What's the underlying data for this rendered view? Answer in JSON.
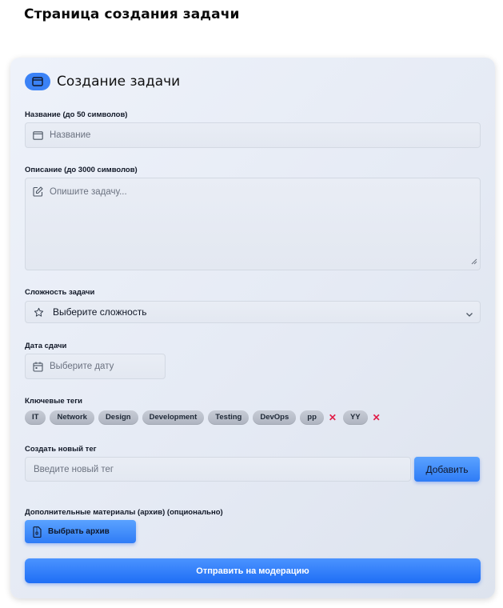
{
  "page": {
    "title": "Страница создания задачи"
  },
  "card": {
    "title": "Создание задачи"
  },
  "form": {
    "name_label": "Название (до 50 символов)",
    "name_placeholder": "Название",
    "desc_label": "Описание (до 3000 символов)",
    "desc_placeholder": "Опишите задачу...",
    "difficulty_label": "Сложность задачи",
    "difficulty_value": "Выберите сложность",
    "date_label": "Дата сдачи",
    "date_placeholder": "Выберите дату",
    "tags_label": "Ключевые теги",
    "tags": [
      {
        "label": "IT",
        "removable": false
      },
      {
        "label": "Network",
        "removable": false
      },
      {
        "label": "Design",
        "removable": false
      },
      {
        "label": "Development",
        "removable": false
      },
      {
        "label": "Testing",
        "removable": false
      },
      {
        "label": "DevOps",
        "removable": false
      },
      {
        "label": "pp",
        "removable": true
      },
      {
        "label": "YY",
        "removable": true
      }
    ],
    "tag_remove_glyph": "✕",
    "new_tag_label": "Создать новый тег",
    "new_tag_placeholder": "Введите новый тег",
    "add_button": "Добавить",
    "attachments_label": "Дополнительные материалы (архив) (опционально)",
    "archive_button": "Выбрать архив",
    "submit_button": "Отправить на модерацию"
  },
  "colors": {
    "accent": "#3b82f6",
    "submit": "#1f6ef5",
    "tag_bg": "#b9bfca",
    "remove": "#e11d48"
  },
  "icons": {
    "header": "window-icon",
    "name": "window-icon",
    "description": "edit-icon",
    "difficulty": "star-icon",
    "date": "calendar-icon",
    "archive": "file-archive-icon"
  }
}
